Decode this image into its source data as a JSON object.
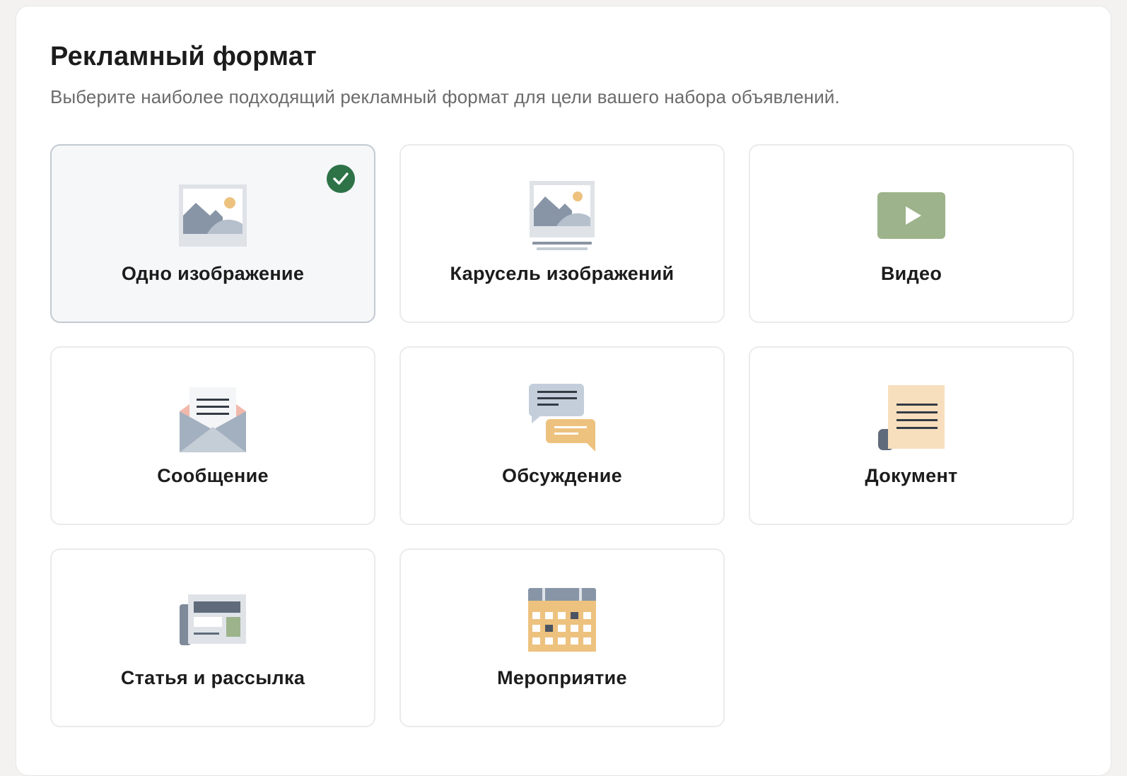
{
  "header": {
    "title": "Рекламный формат",
    "subtitle": "Выберите наиболее подходящий рекламный формат для цели вашего набора объявлений."
  },
  "formats": [
    {
      "label": "Одно изображение",
      "icon": "single-image-icon",
      "selected": true
    },
    {
      "label": "Карусель изображений",
      "icon": "carousel-icon",
      "selected": false
    },
    {
      "label": "Видео",
      "icon": "video-icon",
      "selected": false
    },
    {
      "label": "Сообщение",
      "icon": "envelope-icon",
      "selected": false
    },
    {
      "label": "Обсуждение",
      "icon": "chat-bubbles-icon",
      "selected": false
    },
    {
      "label": "Документ",
      "icon": "document-scroll-icon",
      "selected": false
    },
    {
      "label": "Статья и рассылка",
      "icon": "newspaper-icon",
      "selected": false
    },
    {
      "label": "Мероприятие",
      "icon": "calendar-icon",
      "selected": false
    }
  ],
  "colors": {
    "selected_check": "#2d7347",
    "card_border": "#ebebeb",
    "selected_border": "#c2cad1",
    "selected_bg": "#f5f7f9"
  }
}
